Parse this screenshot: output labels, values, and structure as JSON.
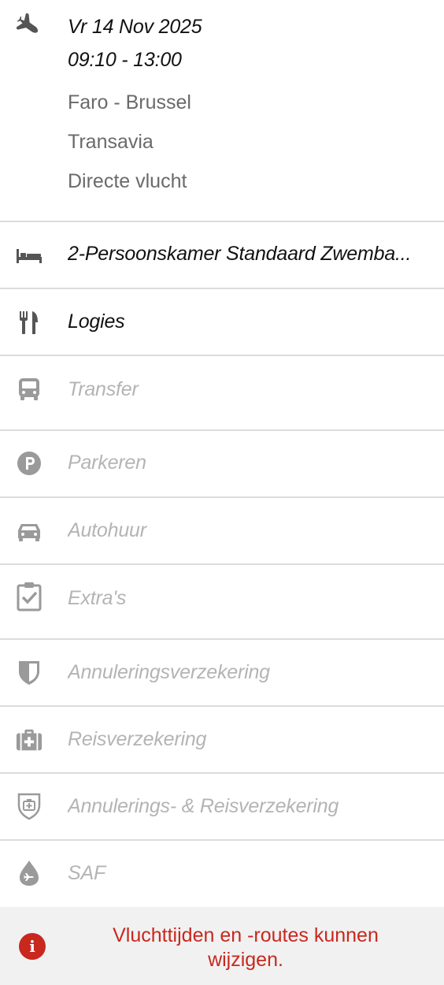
{
  "flight": {
    "icon": "airplane-icon",
    "date": "Vr 14 Nov 2025",
    "time": "09:10 - 13:00",
    "route": "Faro - Brussel",
    "airline": "Transavia",
    "type": "Directe vlucht"
  },
  "items": [
    {
      "icon": "bed-icon",
      "label": "2-Persoonskamer Standaard Zwemba...",
      "active": true
    },
    {
      "icon": "fork-knife-icon",
      "label": "Logies",
      "active": true
    },
    {
      "icon": "bus-icon",
      "label": "Transfer",
      "active": false
    },
    {
      "icon": "parking-icon",
      "label": "Parkeren",
      "active": false
    },
    {
      "icon": "car-icon",
      "label": "Autohuur",
      "active": false
    },
    {
      "icon": "clipboard-check-icon",
      "label": "Extra's",
      "active": false
    },
    {
      "icon": "shield-icon",
      "label": "Annuleringsverzekering",
      "active": false
    },
    {
      "icon": "medical-bag-icon",
      "label": "Reisverzekering",
      "active": false
    },
    {
      "icon": "shield-medical-icon",
      "label": "Annulerings- & Reisverzekering",
      "active": false
    },
    {
      "icon": "fuel-drop-plane-icon",
      "label": "SAF",
      "active": false
    }
  ],
  "notice": {
    "icon": "info-icon",
    "message": "Vluchttijden en -routes kunnen wijzigen."
  },
  "colors": {
    "active_text": "#111111",
    "inactive_text": "#b4b4b4",
    "active_icon": "#555555",
    "inactive_icon": "#9a9a9a",
    "warning": "#c8281e"
  }
}
